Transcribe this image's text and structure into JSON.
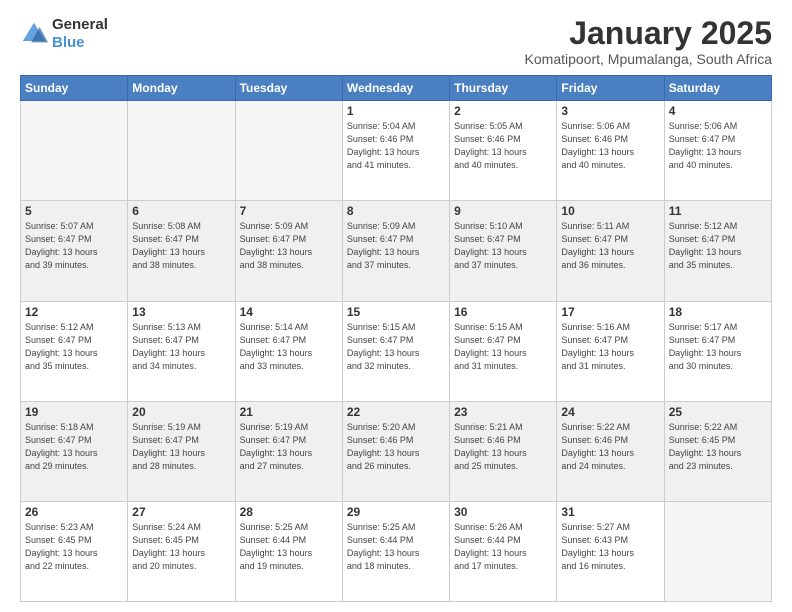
{
  "logo": {
    "general": "General",
    "blue": "Blue"
  },
  "title": "January 2025",
  "subtitle": "Komatipoort, Mpumalanga, South Africa",
  "weekdays": [
    "Sunday",
    "Monday",
    "Tuesday",
    "Wednesday",
    "Thursday",
    "Friday",
    "Saturday"
  ],
  "weeks": [
    [
      {
        "day": "",
        "info": ""
      },
      {
        "day": "",
        "info": ""
      },
      {
        "day": "",
        "info": ""
      },
      {
        "day": "1",
        "info": "Sunrise: 5:04 AM\nSunset: 6:46 PM\nDaylight: 13 hours\nand 41 minutes."
      },
      {
        "day": "2",
        "info": "Sunrise: 5:05 AM\nSunset: 6:46 PM\nDaylight: 13 hours\nand 40 minutes."
      },
      {
        "day": "3",
        "info": "Sunrise: 5:06 AM\nSunset: 6:46 PM\nDaylight: 13 hours\nand 40 minutes."
      },
      {
        "day": "4",
        "info": "Sunrise: 5:06 AM\nSunset: 6:47 PM\nDaylight: 13 hours\nand 40 minutes."
      }
    ],
    [
      {
        "day": "5",
        "info": "Sunrise: 5:07 AM\nSunset: 6:47 PM\nDaylight: 13 hours\nand 39 minutes."
      },
      {
        "day": "6",
        "info": "Sunrise: 5:08 AM\nSunset: 6:47 PM\nDaylight: 13 hours\nand 38 minutes."
      },
      {
        "day": "7",
        "info": "Sunrise: 5:09 AM\nSunset: 6:47 PM\nDaylight: 13 hours\nand 38 minutes."
      },
      {
        "day": "8",
        "info": "Sunrise: 5:09 AM\nSunset: 6:47 PM\nDaylight: 13 hours\nand 37 minutes."
      },
      {
        "day": "9",
        "info": "Sunrise: 5:10 AM\nSunset: 6:47 PM\nDaylight: 13 hours\nand 37 minutes."
      },
      {
        "day": "10",
        "info": "Sunrise: 5:11 AM\nSunset: 6:47 PM\nDaylight: 13 hours\nand 36 minutes."
      },
      {
        "day": "11",
        "info": "Sunrise: 5:12 AM\nSunset: 6:47 PM\nDaylight: 13 hours\nand 35 minutes."
      }
    ],
    [
      {
        "day": "12",
        "info": "Sunrise: 5:12 AM\nSunset: 6:47 PM\nDaylight: 13 hours\nand 35 minutes."
      },
      {
        "day": "13",
        "info": "Sunrise: 5:13 AM\nSunset: 6:47 PM\nDaylight: 13 hours\nand 34 minutes."
      },
      {
        "day": "14",
        "info": "Sunrise: 5:14 AM\nSunset: 6:47 PM\nDaylight: 13 hours\nand 33 minutes."
      },
      {
        "day": "15",
        "info": "Sunrise: 5:15 AM\nSunset: 6:47 PM\nDaylight: 13 hours\nand 32 minutes."
      },
      {
        "day": "16",
        "info": "Sunrise: 5:15 AM\nSunset: 6:47 PM\nDaylight: 13 hours\nand 31 minutes."
      },
      {
        "day": "17",
        "info": "Sunrise: 5:16 AM\nSunset: 6:47 PM\nDaylight: 13 hours\nand 31 minutes."
      },
      {
        "day": "18",
        "info": "Sunrise: 5:17 AM\nSunset: 6:47 PM\nDaylight: 13 hours\nand 30 minutes."
      }
    ],
    [
      {
        "day": "19",
        "info": "Sunrise: 5:18 AM\nSunset: 6:47 PM\nDaylight: 13 hours\nand 29 minutes."
      },
      {
        "day": "20",
        "info": "Sunrise: 5:19 AM\nSunset: 6:47 PM\nDaylight: 13 hours\nand 28 minutes."
      },
      {
        "day": "21",
        "info": "Sunrise: 5:19 AM\nSunset: 6:47 PM\nDaylight: 13 hours\nand 27 minutes."
      },
      {
        "day": "22",
        "info": "Sunrise: 5:20 AM\nSunset: 6:46 PM\nDaylight: 13 hours\nand 26 minutes."
      },
      {
        "day": "23",
        "info": "Sunrise: 5:21 AM\nSunset: 6:46 PM\nDaylight: 13 hours\nand 25 minutes."
      },
      {
        "day": "24",
        "info": "Sunrise: 5:22 AM\nSunset: 6:46 PM\nDaylight: 13 hours\nand 24 minutes."
      },
      {
        "day": "25",
        "info": "Sunrise: 5:22 AM\nSunset: 6:45 PM\nDaylight: 13 hours\nand 23 minutes."
      }
    ],
    [
      {
        "day": "26",
        "info": "Sunrise: 5:23 AM\nSunset: 6:45 PM\nDaylight: 13 hours\nand 22 minutes."
      },
      {
        "day": "27",
        "info": "Sunrise: 5:24 AM\nSunset: 6:45 PM\nDaylight: 13 hours\nand 20 minutes."
      },
      {
        "day": "28",
        "info": "Sunrise: 5:25 AM\nSunset: 6:44 PM\nDaylight: 13 hours\nand 19 minutes."
      },
      {
        "day": "29",
        "info": "Sunrise: 5:25 AM\nSunset: 6:44 PM\nDaylight: 13 hours\nand 18 minutes."
      },
      {
        "day": "30",
        "info": "Sunrise: 5:26 AM\nSunset: 6:44 PM\nDaylight: 13 hours\nand 17 minutes."
      },
      {
        "day": "31",
        "info": "Sunrise: 5:27 AM\nSunset: 6:43 PM\nDaylight: 13 hours\nand 16 minutes."
      },
      {
        "day": "",
        "info": ""
      }
    ]
  ]
}
